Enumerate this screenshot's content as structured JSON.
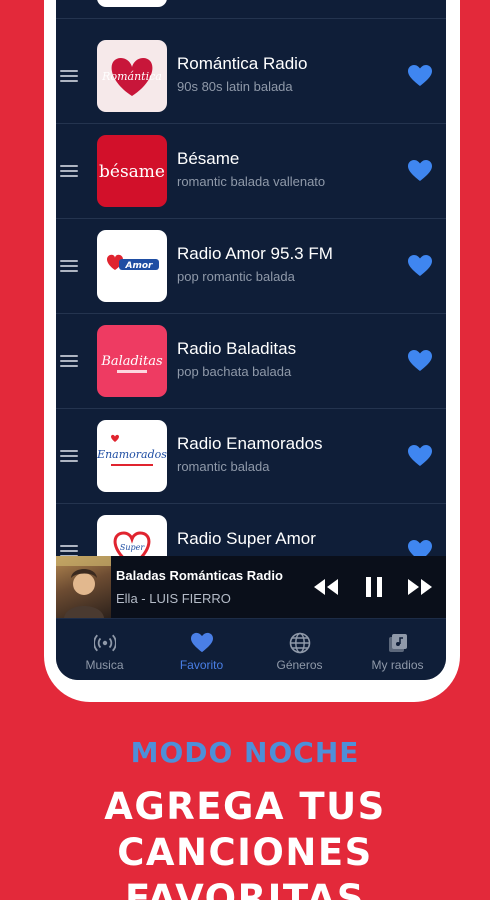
{
  "stations": [
    {
      "name": "",
      "tags": "",
      "logo_bg": "#ffffff"
    },
    {
      "name": "Romántica Radio",
      "tags": "90s 80s latin balada",
      "logo_bg": "#f6e9ea",
      "logo_text": "Romántica"
    },
    {
      "name": "Bésame",
      "tags": "romantic balada vallenato",
      "logo_bg": "#d2102a",
      "logo_text": "bésame"
    },
    {
      "name": "Radio Amor 95.3 FM",
      "tags": "pop romantic balada",
      "logo_bg": "#ffffff",
      "logo_text": "Amor"
    },
    {
      "name": "Radio Baladitas",
      "tags": "pop bachata balada",
      "logo_bg": "#ee3b62",
      "logo_text": "Baladitas"
    },
    {
      "name": "Radio Enamorados",
      "tags": "romantic balada",
      "logo_bg": "#ffffff",
      "logo_text": "Enamorados"
    },
    {
      "name": "Radio Super Amor",
      "tags": "",
      "logo_bg": "#ffffff",
      "logo_text": "Super"
    }
  ],
  "player": {
    "title": "Baladas Románticas Radio",
    "subtitle": "Ella - LUIS FIERRO"
  },
  "nav": {
    "items": [
      {
        "label": "Musica",
        "icon": "radio-waves-icon"
      },
      {
        "label": "Favorito",
        "icon": "heart-icon"
      },
      {
        "label": "Géneros",
        "icon": "globe-icon"
      },
      {
        "label": "My radios",
        "icon": "library-icon"
      }
    ],
    "active": "Favorito"
  },
  "promo": {
    "subtitle": "MODO NOCHE",
    "title_line1": "AGREGA TUS CANCIONES",
    "title_line2": "FAVORITAS"
  },
  "colors": {
    "background": "#e3293a",
    "screen": "#0f1e38",
    "accent": "#4a7fe6",
    "heart": "#3f86f0",
    "promo_subtitle": "#4e8fd8"
  }
}
